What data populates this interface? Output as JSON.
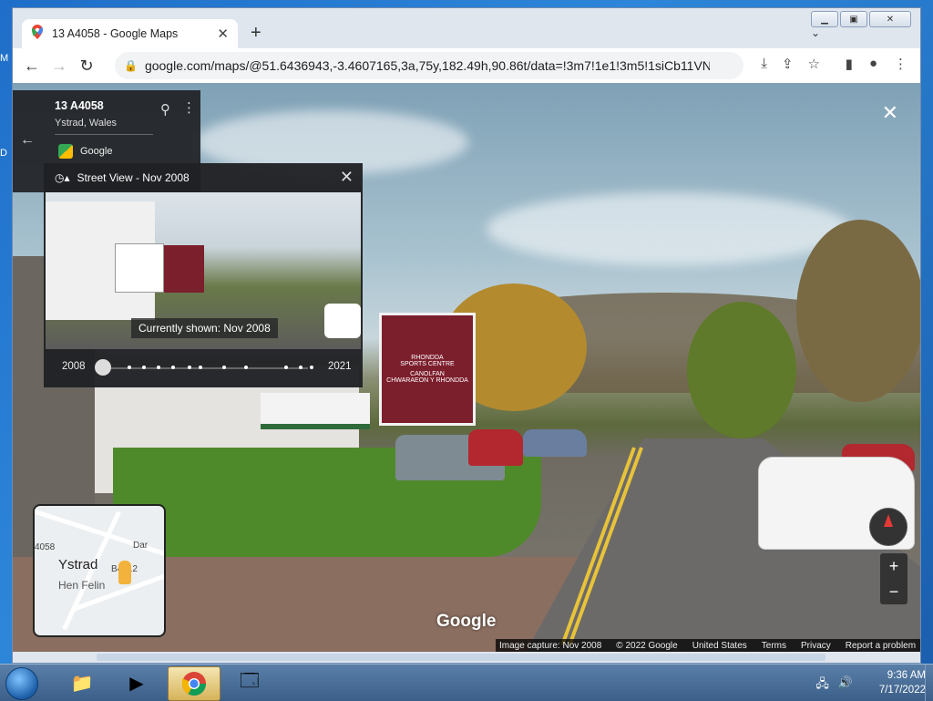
{
  "browser": {
    "tab_title": "13 A4058 - Google Maps",
    "url": "google.com/maps/@51.6436943,-3.4607165,3a,75y,182.49h,90.86t/data=!3m7!1e1!3m5!1siCb11VN_4..."
  },
  "place_card": {
    "title": "13 A4058",
    "subtitle": "Ystrad, Wales",
    "source": "Google"
  },
  "time_machine": {
    "header": "Street View - Nov 2008",
    "caption": "Currently shown: Nov 2008",
    "year_start": "2008",
    "year_end": "2021",
    "selected_index": 0
  },
  "scene_signs": {
    "main_sign_line1": "RHONDDA",
    "main_sign_line2": "SPORTS CENTRE",
    "main_sign_line3": "CANOLFAN",
    "main_sign_line4": "CHWARAEON Y RHONDDA"
  },
  "minimap": {
    "town": "Ystrad",
    "road_1": "4058",
    "road_2": "B4512",
    "place": "Hen Felin",
    "partial": "Dar"
  },
  "footer": {
    "capture": "Image capture: Nov 2008",
    "copyright": "© 2022 Google",
    "country": "United States",
    "terms": "Terms",
    "privacy": "Privacy",
    "report": "Report a problem"
  },
  "logo": "Google",
  "taskbar": {
    "time": "9:36 AM",
    "date": "7/17/2022"
  }
}
